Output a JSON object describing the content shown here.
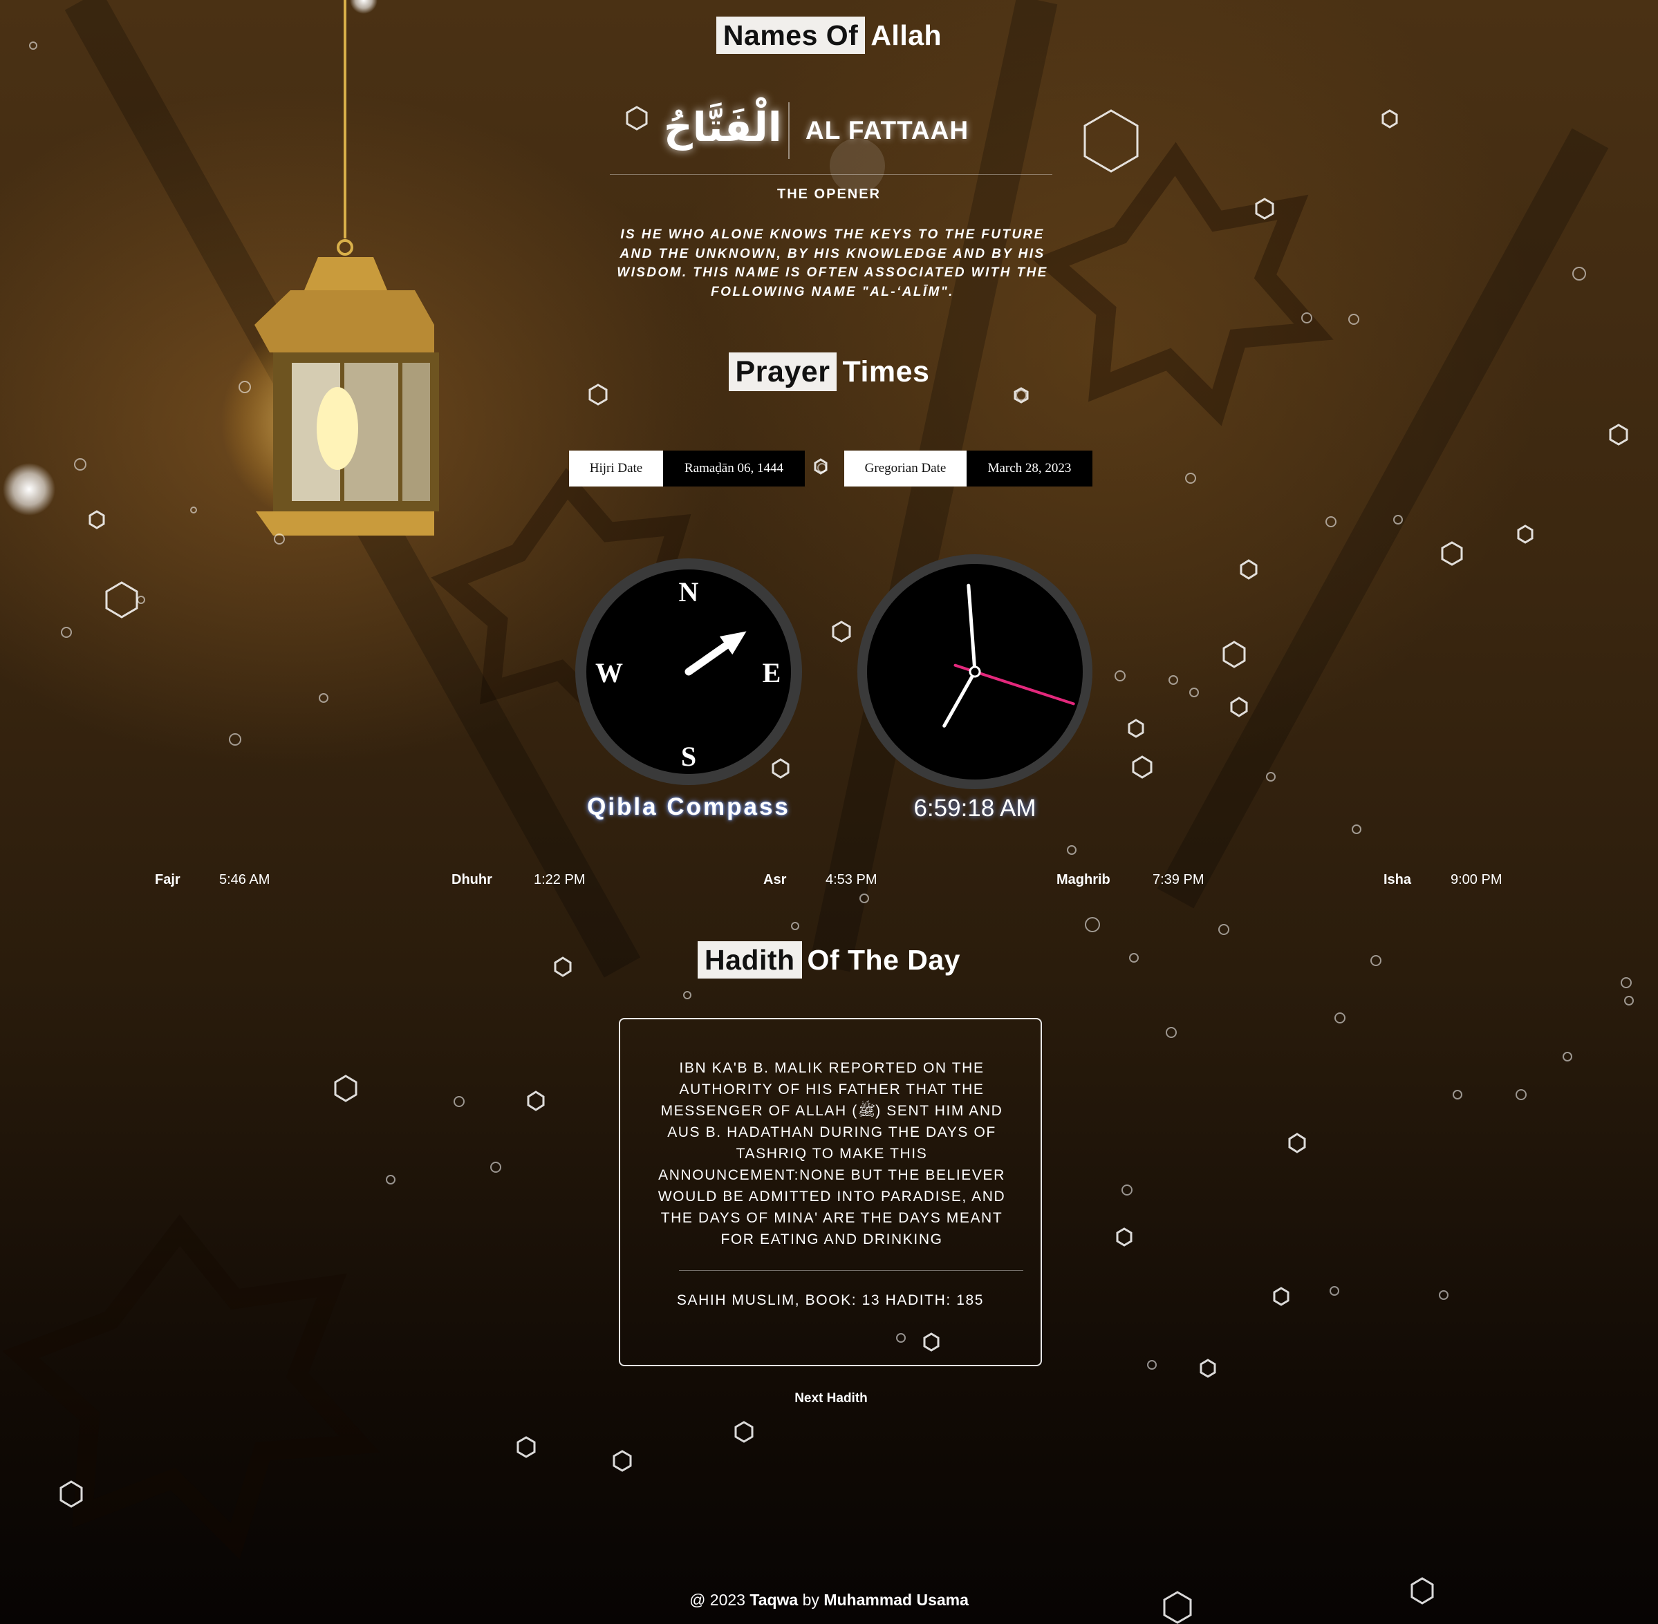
{
  "names_section": {
    "title_highlight": "Names Of",
    "title_rest": "Allah",
    "arabic_name": "الْفَتَّاحُ",
    "transliteration": "AL FATTAAH",
    "meaning": "THE OPENER",
    "description": "IS HE WHO ALONE KNOWS THE KEYS TO THE FUTURE AND THE UNKNOWN, BY HIS KNOWLEDGE AND BY HIS WISDOM. THIS NAME IS OFTEN ASSOCIATED WITH THE FOLLOWING NAME \"AL-‘ALĪM\"."
  },
  "prayer_section": {
    "title_highlight": "Prayer",
    "title_rest": "Times",
    "hijri": {
      "label": "Hijri Date",
      "value": "Ramaḍān 06, 1444"
    },
    "gregorian": {
      "label": "Gregorian Date",
      "value": "March 28, 2023"
    },
    "compass": {
      "north": "N",
      "south": "S",
      "east": "E",
      "west": "W",
      "label": "Qibla Compass",
      "needle_bearing_deg": 55
    },
    "clock": {
      "time_text": "6:59:18 AM",
      "hour": 6,
      "minute": 59,
      "second": 18,
      "second_hand_color": "#e3287c"
    },
    "prayers": [
      {
        "name": "Fajr",
        "time": "5:46 AM"
      },
      {
        "name": "Dhuhr",
        "time": "1:22 PM"
      },
      {
        "name": "Asr",
        "time": "4:53 PM"
      },
      {
        "name": "Maghrib",
        "time": "7:39 PM"
      },
      {
        "name": "Isha",
        "time": "9:00 PM"
      }
    ]
  },
  "hadith_section": {
    "title_highlight": "Hadith",
    "title_rest": "Of The Day",
    "text": "IBN KA'B B. MALIK REPORTED ON THE AUTHORITY OF HIS FATHER THAT THE MESSENGER OF ALLAH (ﷺ) SENT HIM AND AUS B. HADATHAN DURING THE DAYS OF TASHRIQ TO MAKE THIS ANNOUNCEMENT:NONE BUT THE BELIEVER WOULD BE ADMITTED INTO PARADISE, AND THE DAYS OF MINA' ARE THE DAYS MEANT FOR EATING AND DRINKING",
    "reference": "SAHIH MUSLIM, BOOK: 13 HADITH: 185",
    "next_button": "Next Hadith"
  },
  "footer": {
    "prefix": "@ 2023",
    "brand": "Taqwa",
    "by": "by",
    "author": "Muhammad Usama"
  },
  "colors": {
    "highlight_bg": "#f1efec",
    "background_top": "#4a3114",
    "background_bottom": "#070403",
    "lantern_gold": "#d9b04a"
  }
}
